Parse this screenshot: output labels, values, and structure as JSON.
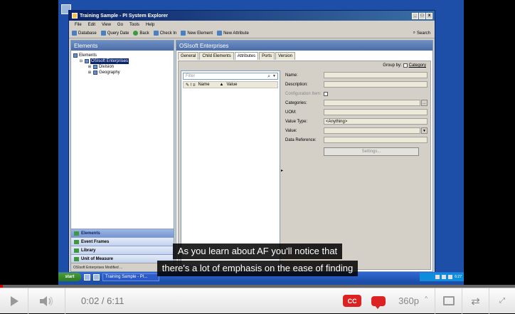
{
  "app": {
    "title": "Training Sample - PI System Explorer",
    "menus": [
      "File",
      "Edit",
      "View",
      "Go",
      "Tools",
      "Help"
    ],
    "toolbar": [
      "Database",
      "Query Date",
      "Back",
      "Check In",
      "New Element",
      "New Attribute"
    ],
    "search_label": "Search",
    "window_buttons": [
      "_",
      "□",
      "x"
    ]
  },
  "left_pane": {
    "header": "Elements",
    "tree": [
      {
        "label": "Elements",
        "level": 0
      },
      {
        "label": "OSIsoft Enterprises",
        "level": 1,
        "selected": true
      },
      {
        "label": "Division",
        "level": 2
      },
      {
        "label": "Geography",
        "level": 2
      }
    ],
    "nav": [
      "Elements",
      "Event Frames",
      "Library",
      "Unit of Measure"
    ],
    "status": "OSIsoft Enterprises  Modified ..."
  },
  "right_pane": {
    "header": "OSIsoft Enterprises",
    "tabs": [
      "General",
      "Child Elements",
      "Attributes",
      "Ports",
      "Version"
    ],
    "active_tab": "Attributes",
    "group_by_label": "Group by:",
    "group_by_option": "Category",
    "filter_placeholder": "Filter",
    "columns": [
      "Name",
      "Value"
    ],
    "properties": {
      "name": "Name:",
      "description": "Description:",
      "config_item": "Configuration Item:",
      "categories": "Categories:",
      "uom": "UOM:",
      "value_type": "Value Type:",
      "value_type_value": "<Anything>",
      "value": "Value:",
      "data_reference": "Data Reference:"
    },
    "settings_button": "Settings..."
  },
  "taskbar": {
    "start": "start",
    "task": "Training Sample - PI...",
    "clock": "6:27"
  },
  "captions": [
    "As you learn about AF you'll notice that",
    "there's a lot of emphasis on the ease of finding"
  ],
  "player": {
    "time": "0:02 / 6:11",
    "progress_fraction": 0.0054,
    "cc": "CC",
    "quality": "360p"
  },
  "colors": {
    "progress": "#cc0000",
    "cc_badge": "#dd2222"
  }
}
